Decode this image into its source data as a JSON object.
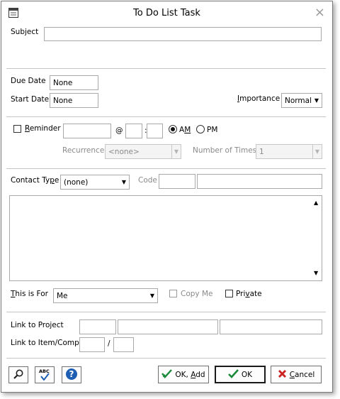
{
  "window": {
    "title": "To Do List Task",
    "close_glyph": "×"
  },
  "subject": {
    "label": "Subject",
    "value": ""
  },
  "dates": {
    "due_label": "Due Date",
    "due_value": "None",
    "start_label": "Start Date",
    "start_value": "None"
  },
  "importance": {
    "label": "Importance",
    "value": "Normal"
  },
  "reminder": {
    "label": "Reminder",
    "checked": false,
    "at_symbol": "@",
    "time_colon": ":",
    "am_label": "AM",
    "pm_label": "PM",
    "selected_period": "AM",
    "recurrence_label": "Recurrence",
    "recurrence_value": "<none>",
    "times_label": "Number of Times",
    "times_value": "1"
  },
  "contact": {
    "type_label": "Contact Type",
    "type_value": "(none)",
    "code_label": "Code"
  },
  "notes": {
    "value": ""
  },
  "this_is_for": {
    "label": "This is For",
    "value": "Me",
    "copy_me_label": "Copy Me",
    "private_label": "Private"
  },
  "links": {
    "project_label": "Link to Project",
    "item_label": "Link to Item/Comp.",
    "slash": "/"
  },
  "buttons": {
    "ok_add": "OK, Add",
    "ok": "OK",
    "cancel": "Cancel",
    "spell_abc": "ABC"
  },
  "icons": {
    "app": "window-icon",
    "search": "magnifier-icon",
    "spell": "spellcheck-icon",
    "help": "help-icon",
    "ok_add": "checkmark-plus-icon",
    "ok": "checkmark-icon",
    "cancel": "x-icon"
  },
  "colors": {
    "help_blue": "#1e5fb4",
    "ok_green": "#1a8a3a",
    "cancel_red": "#cc2222"
  }
}
